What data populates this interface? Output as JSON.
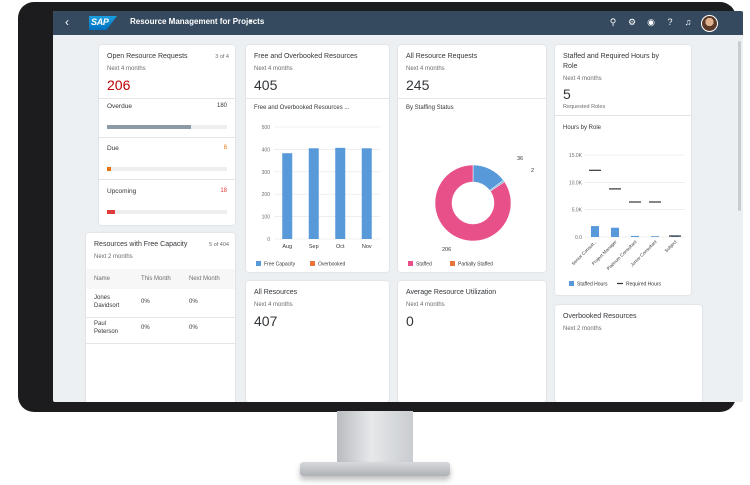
{
  "shell": {
    "app_title": "Resource Management for Projects",
    "logo_text": "SAP"
  },
  "cards": {
    "open_requests": {
      "title": "Open Resource Requests",
      "counter": "3 of 4",
      "subtitle": "Next 4 months",
      "kpi": "206",
      "rows": [
        {
          "label": "Overdue",
          "value": "180",
          "fraction": 0.7,
          "color": "#8c9aa6"
        },
        {
          "label": "Due",
          "value": "8",
          "fraction": 0.03,
          "color": "#e9730c"
        },
        {
          "label": "Upcoming",
          "value": "18",
          "fraction": 0.07,
          "color": "#e03b3b"
        }
      ]
    },
    "free_capacity": {
      "title": "Resources with Free Capacity",
      "counter": "5 of 404",
      "subtitle": "Next 2 months",
      "columns": [
        "Name",
        "This Month",
        "Next Month"
      ],
      "rows": [
        {
          "name_line1": "Jones",
          "name_line2": "Davidsort",
          "this_month": "0%",
          "next_month": "0%"
        },
        {
          "name_line1": "Paul",
          "name_line2": "Peterson",
          "this_month": "0%",
          "next_month": "0%"
        }
      ]
    },
    "free_overbooked": {
      "title": "Free and Overbooked Resources",
      "subtitle": "Next 4 months",
      "kpi": "405",
      "chart_title": "Free and Overbooked Resources ..."
    },
    "all_resources_status": {
      "title": "All Resource Requests",
      "subtitle": "Next 4 months",
      "kpi": "245",
      "chart_title": "By Staffing Status"
    },
    "staffed_required": {
      "title": "Staffed and Required Hours by",
      "title_line2": "Role",
      "subtitle": "Next 4 months",
      "kpi": "5",
      "kpi_caption": "Requested Roles",
      "chart_title": "Hours by Role"
    },
    "all_resources": {
      "title": "All Resources",
      "subtitle": "Next 4 months",
      "kpi": "407"
    },
    "utilization": {
      "title": "Average Resource Utilization",
      "subtitle": "Next 4 months",
      "kpi": "0"
    },
    "overbooked": {
      "title": "Overbooked Resources",
      "subtitle": "Next 2 months"
    }
  },
  "chart_data": [
    {
      "type": "bar",
      "categories": [
        "Aug",
        "Sep",
        "Oct",
        "Nov"
      ],
      "series": [
        {
          "name": "Free Capacity",
          "values": [
            383,
            405,
            407,
            405
          ],
          "color": "#5899da"
        },
        {
          "name": "Overbooked",
          "values": [
            0,
            0,
            0,
            0
          ],
          "color": "#e8743b"
        }
      ],
      "yticks": [
        "0",
        "100",
        "200",
        "300",
        "400",
        "500"
      ],
      "ylim": [
        0,
        500
      ]
    },
    {
      "type": "pie",
      "slices": [
        {
          "name": "Staffed",
          "value": 206,
          "color": "#e8508a"
        },
        {
          "name": "Partially Staffed",
          "value": 36,
          "color": "#5899da"
        },
        {
          "name": "",
          "value": 2,
          "color": "#7fbce0"
        }
      ],
      "labels": [
        "206",
        "36",
        "2"
      ],
      "legend": [
        "Staffed",
        "Partially Staffed"
      ]
    },
    {
      "type": "bar",
      "categories": [
        "Senior Consult...",
        "Project Manager",
        "Platinum Consultant",
        "Junior Consultant",
        "Subject"
      ],
      "series": [
        {
          "name": "Staffed Hours",
          "values": [
            2000,
            1700,
            200,
            150,
            100
          ],
          "color": "#5899da"
        },
        {
          "name": "Required Hours",
          "values": [
            12200,
            8800,
            6400,
            6400,
            0
          ],
          "color": "#32363a"
        }
      ],
      "yticks": [
        "0.0",
        "5.0K",
        "10.0K",
        "15.0K"
      ],
      "ylim": [
        0,
        15000
      ]
    }
  ]
}
